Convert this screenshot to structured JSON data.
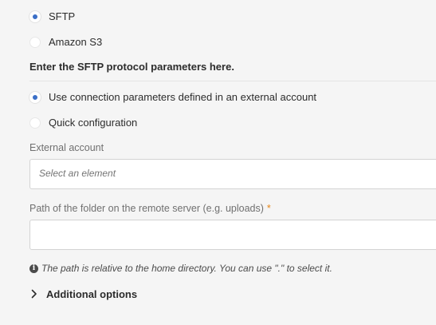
{
  "protocol": {
    "options": [
      {
        "label": "SFTP",
        "checked": true
      },
      {
        "label": "Amazon S3",
        "checked": false
      }
    ]
  },
  "sftp": {
    "heading": "Enter the SFTP protocol parameters here.",
    "mode_options": [
      {
        "label": "Use connection parameters defined in an external account",
        "checked": true
      },
      {
        "label": "Quick configuration",
        "checked": false
      }
    ],
    "external_account": {
      "label": "External account",
      "placeholder": "Select an element"
    },
    "folder_path": {
      "label": "Path of the folder on the remote server (e.g. uploads)",
      "required_marker": "*",
      "value": ""
    },
    "help": {
      "icon": "info-icon",
      "icon_glyph": "i",
      "text": "The path is relative to the home directory. You can use \".\" to select it."
    },
    "additional_options": {
      "label": "Additional options",
      "icon": "chevron-right-icon"
    }
  },
  "colors": {
    "accent": "#3b6fc7",
    "required": "#e68619",
    "background": "#f5f5f5"
  }
}
